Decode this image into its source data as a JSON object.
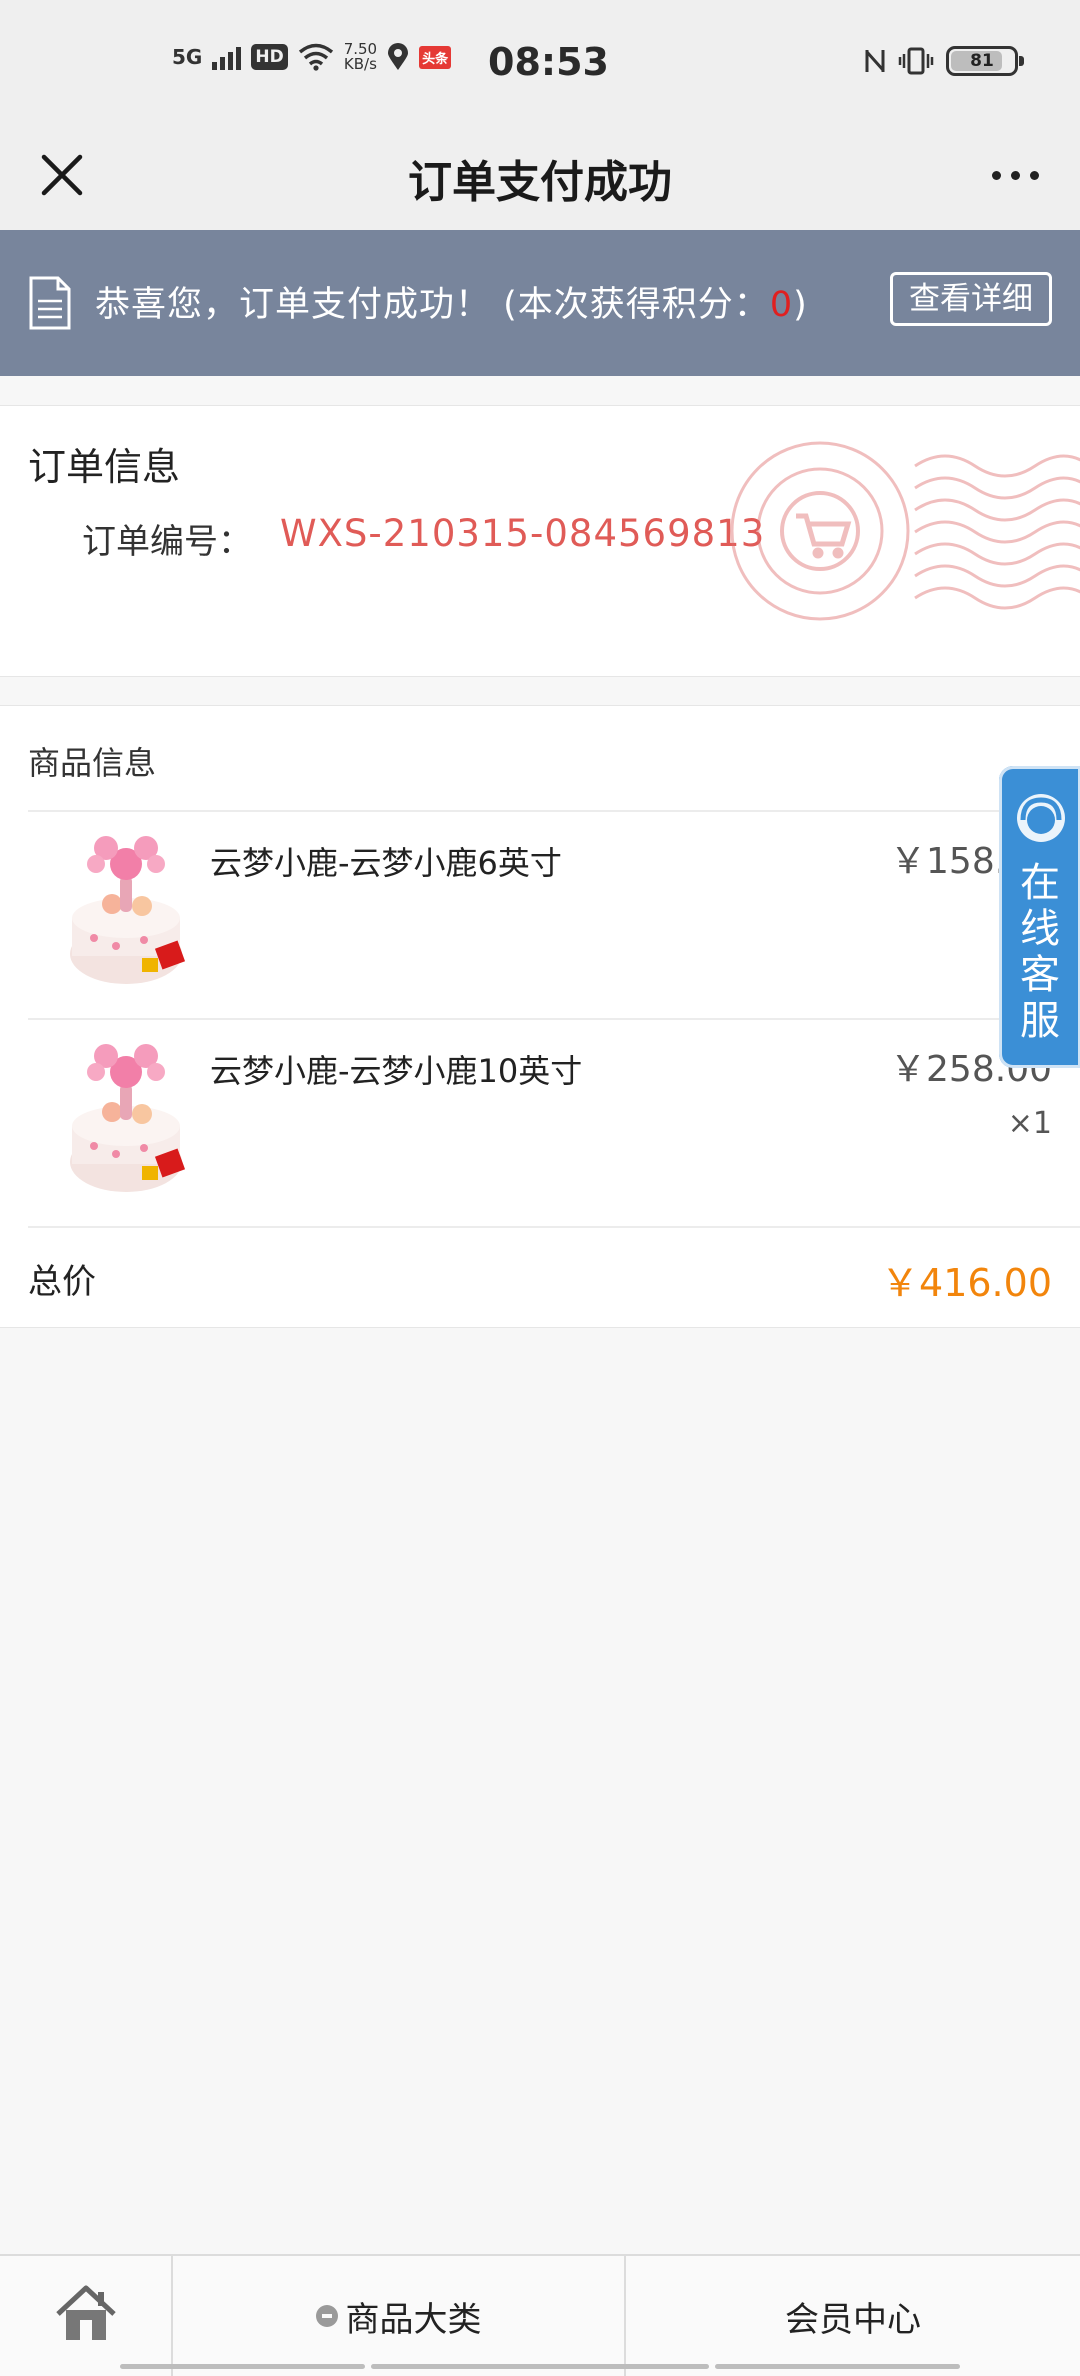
{
  "status_bar": {
    "network": "5G",
    "hd": "HD",
    "speed_value": "7.50",
    "speed_unit": "KB/s",
    "app_badge": "头条",
    "time": "08:53",
    "battery": "81"
  },
  "nav": {
    "title": "订单支付成功"
  },
  "banner": {
    "message": "恭喜您，订单支付成功！",
    "points_prefix": "(本次获得积分：",
    "points_value": "0",
    "points_suffix": ")",
    "details_button": "查看详细",
    "bg_color": "#78859c"
  },
  "order": {
    "title": "订单信息",
    "number_label": "订单编号：",
    "number_value": "WXS-210315-084569813"
  },
  "goods": {
    "header": "商品信息",
    "items": [
      {
        "name": "云梦小鹿-云梦小鹿6英寸",
        "price": "￥158.00",
        "qty": ""
      },
      {
        "name": "云梦小鹿-云梦小鹿10英寸",
        "price": "￥258.00",
        "qty": "×1"
      }
    ],
    "total_label": "总价",
    "total_value": "￥416.00",
    "accent_color": "#f2850c"
  },
  "customer_service": {
    "chars": [
      "在",
      "线",
      "客",
      "服"
    ]
  },
  "tabbar": {
    "category_label": "商品大类",
    "member_label": "会员中心"
  }
}
